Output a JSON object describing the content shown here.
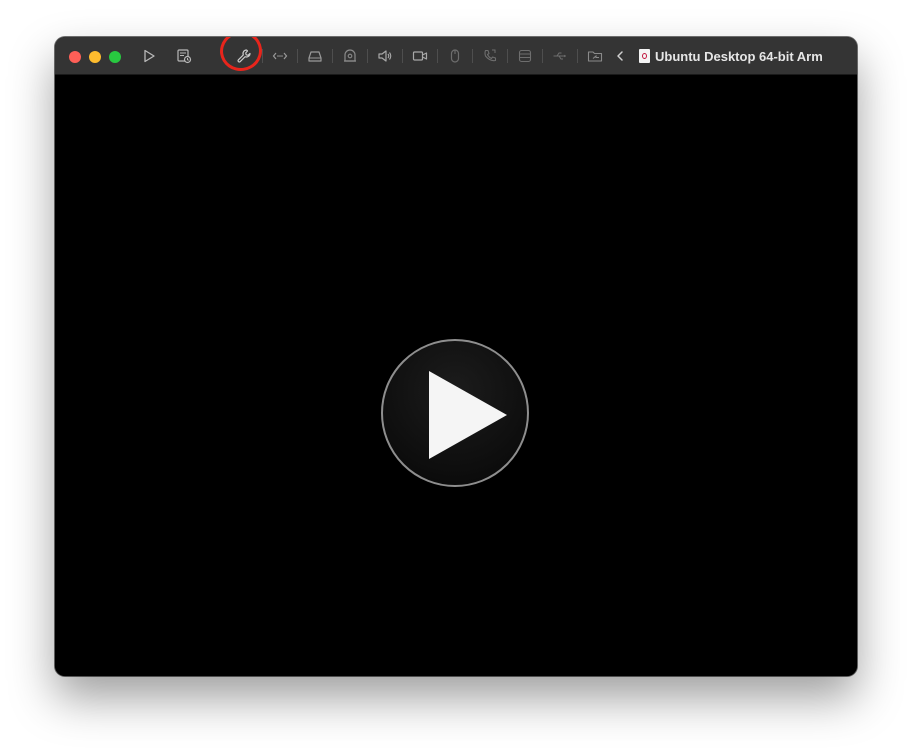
{
  "window": {
    "title": "Ubuntu Desktop 64-bit Arm"
  },
  "titlebar": {
    "traffic_lights": [
      "close",
      "minimize",
      "zoom"
    ],
    "toolbar_icons": [
      "play-icon",
      "snapshot-icon",
      "wrench-icon",
      "network-icon",
      "hard-disk-icon",
      "camera-icon",
      "sound-icon",
      "camera-video-icon",
      "mouse-icon",
      "phone-icon",
      "database-icon",
      "usb-icon",
      "shared-folder-icon",
      "chevron-left-icon"
    ],
    "highlighted_icon": "wrench-icon",
    "highlight_color": "#e8251c"
  },
  "display": {
    "state": "powered-off",
    "overlay_icon": "play-icon"
  },
  "colors": {
    "titlebar": "#343434",
    "display_bg": "#000000",
    "close": "#fe5f57",
    "minimize": "#febc2e",
    "zoom": "#28c840"
  }
}
